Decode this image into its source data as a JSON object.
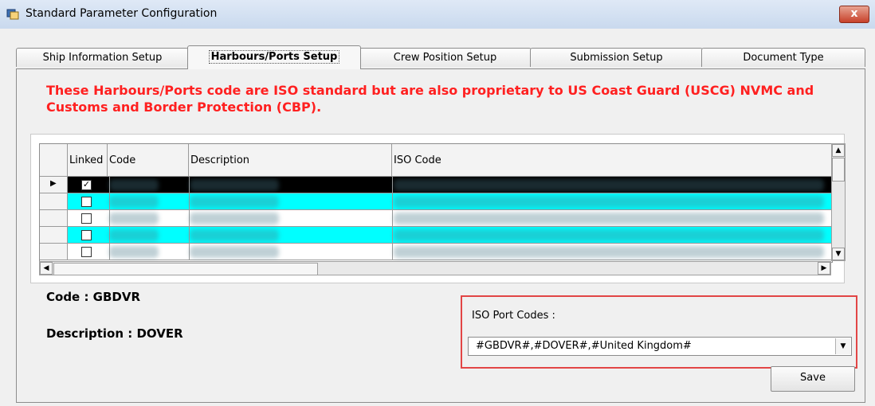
{
  "window": {
    "title": "Standard Parameter Configuration",
    "close_label": "x"
  },
  "tabs": [
    {
      "label": "Ship Information Setup",
      "active": false
    },
    {
      "label": "Harbours/Ports Setup",
      "active": true
    },
    {
      "label": "Crew Position Setup",
      "active": false
    },
    {
      "label": "Submission Setup",
      "active": false
    },
    {
      "label": "Document Type",
      "active": false
    }
  ],
  "warning": "These Harbours/Ports code are ISO standard but are also proprietary to US Coast Guard (USCG) NVMC and Customs and Border Protection (CBP).",
  "grid": {
    "columns": [
      "Linked",
      "Code",
      "Description",
      "ISO Code"
    ],
    "rows": [
      {
        "linked": true,
        "selected": true,
        "color": "#000000"
      },
      {
        "linked": false,
        "selected": false,
        "color": "#00ffff"
      },
      {
        "linked": false,
        "selected": false,
        "color": "#ffffff"
      },
      {
        "linked": false,
        "selected": false,
        "color": "#00ffff"
      },
      {
        "linked": false,
        "selected": false,
        "color": "#ffffff"
      }
    ],
    "check_mark": "✓",
    "row_pointer": "▶"
  },
  "detail": {
    "code_label": "Code : GBDVR",
    "description_label": "Description : DOVER"
  },
  "iso": {
    "label": "ISO Port Codes :",
    "value": "#GBDVR#,#DOVER#,#United Kingdom#"
  },
  "save_label": "Save",
  "colors": {
    "warning": "#ff2020",
    "highlight_border": "#e24545",
    "alt_row": "#00ffff",
    "selected_row": "#000000"
  }
}
